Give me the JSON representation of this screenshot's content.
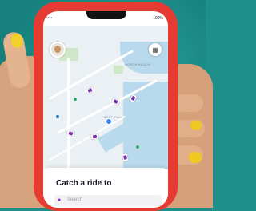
{
  "status_bar": {
    "time": "4:30 PM",
    "signal": "•••• ",
    "battery": "100%"
  },
  "map": {
    "labels": {
      "north_beach": "NORTH BEACH",
      "att_park": "AT&T Park"
    }
  },
  "icons": {
    "avatar": "user-avatar",
    "calendar": "calendar-icon",
    "search": "search-icon"
  },
  "sheet": {
    "title": "Catch a ride to",
    "search_placeholder": "Search"
  },
  "colors": {
    "accent": "#8a2be2",
    "case": "#e53b32",
    "background": "#1f8f8c"
  }
}
